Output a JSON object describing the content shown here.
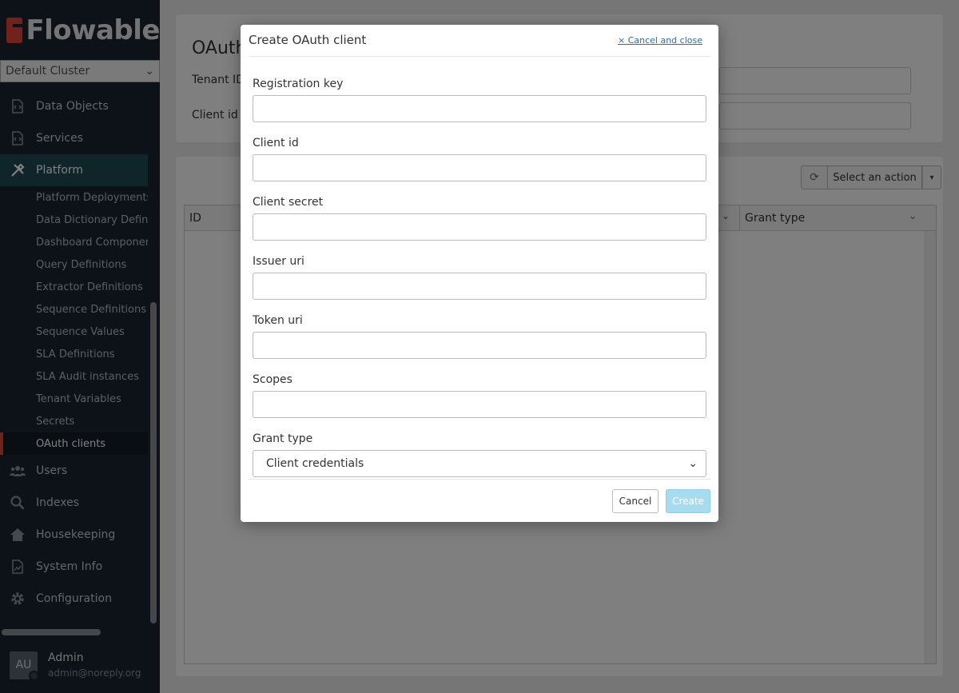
{
  "app": {
    "logo_text": "Flowable",
    "cluster": "Default Cluster"
  },
  "sidebar": {
    "items": [
      {
        "label": "Data Objects",
        "icon": "code-file-icon"
      },
      {
        "label": "Services",
        "icon": "code-file-icon"
      },
      {
        "label": "Platform",
        "icon": "tools-icon"
      }
    ],
    "sub_items": [
      "Platform Deployments",
      "Data Dictionary Definiti",
      "Dashboard Component",
      "Query Definitions",
      "Extractor Definitions",
      "Sequence Definitions",
      "Sequence Values",
      "SLA Definitions",
      "SLA Audit instances",
      "Tenant Variables",
      "Secrets",
      "OAuth clients"
    ],
    "bottom_items": [
      {
        "label": "Users",
        "icon": "users-icon"
      },
      {
        "label": "Indexes",
        "icon": "search-icon"
      },
      {
        "label": "Housekeeping",
        "icon": "house-icon"
      },
      {
        "label": "System Info",
        "icon": "chart-file-icon"
      },
      {
        "label": "Configuration",
        "icon": "gear-icon"
      }
    ]
  },
  "user": {
    "initials": "AU",
    "name": "Admin",
    "email": "admin@noreply.org"
  },
  "page": {
    "title": "OAuth",
    "filters": {
      "tenant_label": "Tenant ID",
      "client_label": "Client id"
    },
    "toolbar": {
      "action_label": "Select an action"
    },
    "grid": {
      "col_id": "ID",
      "col_grant": "Grant type"
    }
  },
  "modal": {
    "title": "Create OAuth client",
    "close_label": "× Cancel and close",
    "fields": {
      "registration_key": "Registration key",
      "client_id": "Client id",
      "client_secret": "Client secret",
      "issuer_uri": "Issuer uri",
      "token_uri": "Token uri",
      "scopes": "Scopes",
      "grant_type": "Grant type"
    },
    "grant_type_value": "Client credentials",
    "cancel_label": "Cancel",
    "create_label": "Create"
  }
}
